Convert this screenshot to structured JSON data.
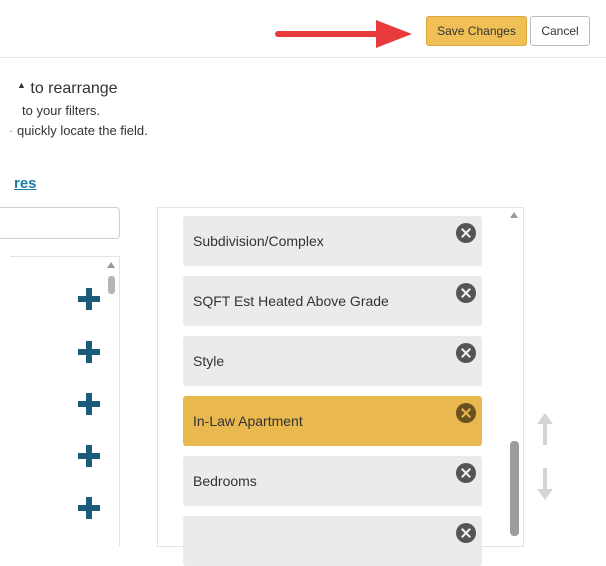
{
  "header": {
    "save_label": "Save Changes",
    "cancel_label": "Cancel"
  },
  "instructions": {
    "line1": "to rearrange",
    "line2": "to your filters.",
    "line3": "quickly locate the field."
  },
  "link_text": "res",
  "selected_fields": [
    {
      "label": "Subdivision/Complex",
      "selected": false
    },
    {
      "label": "SQFT Est Heated Above Grade",
      "selected": false
    },
    {
      "label": "Style",
      "selected": false
    },
    {
      "label": "In-Law Apartment",
      "selected": true
    },
    {
      "label": "Bedrooms",
      "selected": false
    }
  ],
  "icons": {
    "remove": "close-circle-icon",
    "add": "plus-icon",
    "move_up": "arrow-up-icon",
    "move_down": "arrow-down-icon",
    "annotation": "red-arrow-annotation"
  },
  "colors": {
    "save_button": "#f0c057",
    "selected_item": "#e9b84f",
    "item_background": "#ebebeb",
    "plus_icon": "#1c5b7a",
    "link": "#1d7aa8",
    "annotation_arrow": "#e83a3a"
  }
}
